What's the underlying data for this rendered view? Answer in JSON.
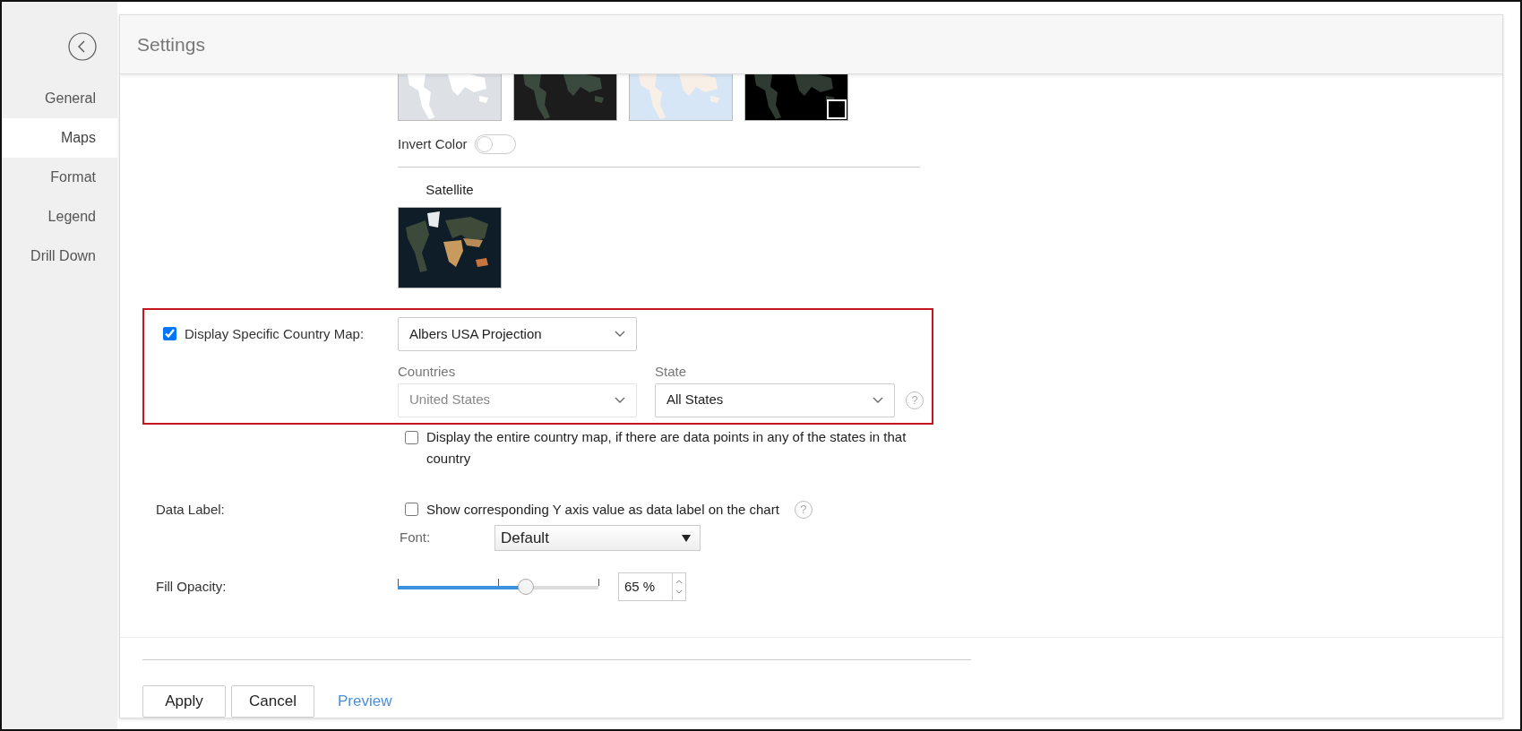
{
  "sidebar": {
    "items": [
      {
        "label": "General",
        "selected": false
      },
      {
        "label": "Maps",
        "selected": true
      },
      {
        "label": "Format",
        "selected": false
      },
      {
        "label": "Legend",
        "selected": false
      },
      {
        "label": "Drill Down",
        "selected": false
      }
    ]
  },
  "header": {
    "title": "Settings"
  },
  "map_styles": [
    {
      "kind": "light",
      "selected": false
    },
    {
      "kind": "dark",
      "selected": false
    },
    {
      "kind": "blue",
      "selected": false
    },
    {
      "kind": "black",
      "selected": true
    }
  ],
  "invert_color": {
    "label": "Invert Color",
    "on": false
  },
  "satellite": {
    "label": "Satellite"
  },
  "country_map": {
    "highlighted": true,
    "checked": true,
    "label": "Display Specific Country Map:",
    "projection": "Albers USA Projection",
    "countries_label": "Countries",
    "countries": "United States",
    "countries_disabled": true,
    "state_label": "State",
    "state": "All States",
    "help": "?"
  },
  "entire_country": {
    "checked": false,
    "label": "Display the entire country map, if there are data points in any of the states in that country"
  },
  "data_label": {
    "label": "Data Label:",
    "checked": false,
    "text": "Show corresponding Y axis value as data label on the chart",
    "help": "?",
    "font_label": "Font:",
    "font": "Default"
  },
  "fill_opacity": {
    "label": "Fill Opacity:",
    "level": 0.64,
    "value": "65 %"
  },
  "buttons": [
    {
      "label": "Apply",
      "kind": "button"
    },
    {
      "label": "Cancel",
      "kind": "button"
    },
    {
      "label": "Preview",
      "kind": "link"
    }
  ]
}
